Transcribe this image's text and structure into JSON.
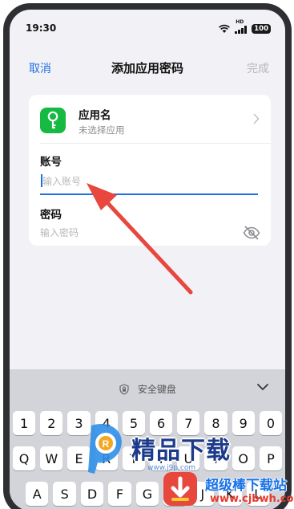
{
  "status_bar": {
    "time": "19:30",
    "signal_badge": "HD",
    "battery": "100"
  },
  "nav": {
    "cancel": "取消",
    "title": "添加应用密码",
    "done": "完成"
  },
  "app_row": {
    "label": "应用名",
    "placeholder": "未选择应用",
    "icon": "key-icon",
    "icon_color": "#16b941"
  },
  "account": {
    "label": "账号",
    "placeholder": "输入账号",
    "value": ""
  },
  "password": {
    "label": "密码",
    "placeholder": "输入密码",
    "value": "",
    "visibility_icon": "eye-off-icon"
  },
  "keyboard": {
    "title": "安全键盘",
    "rows": [
      [
        "1",
        "2",
        "3",
        "4",
        "5",
        "6",
        "7",
        "8",
        "9",
        "0"
      ],
      [
        "Q",
        "W",
        "E",
        "R",
        "T",
        "Y",
        "U",
        "I",
        "O",
        "P"
      ],
      [
        "A",
        "S",
        "D",
        "F",
        "G",
        "H",
        "J",
        "K",
        "L"
      ]
    ]
  },
  "watermarks": [
    {
      "text": "精品下载",
      "url": "www.j9p.com"
    },
    {
      "text": "超级棒下载站",
      "url": "www.cjbwh.com"
    }
  ],
  "colors": {
    "accent": "#1f6fe5",
    "app_icon": "#16b941",
    "arrow": "#e8473e",
    "background": "#f2f2f6",
    "keyboard_bg": "#d2d4d9"
  }
}
